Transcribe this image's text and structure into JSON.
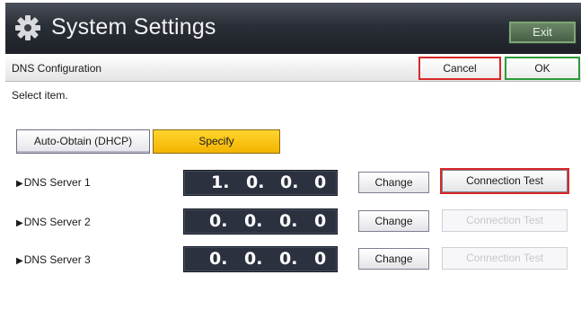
{
  "window": {
    "title": "System Settings",
    "exit_label": "Exit"
  },
  "header": {
    "page_title": "DNS Configuration",
    "cancel_label": "Cancel",
    "ok_label": "OK"
  },
  "prompt": "Select item.",
  "mode": {
    "auto_label": "Auto-Obtain (DHCP)",
    "specify_label": "Specify",
    "selected": "Specify"
  },
  "dns_servers": [
    {
      "label": "DNS Server 1",
      "octets": [
        "1.",
        "0.",
        "0.",
        "0"
      ],
      "change_label": "Change",
      "test_label": "Connection Test",
      "test_enabled": true
    },
    {
      "label": "DNS Server 2",
      "octets": [
        "0.",
        "0.",
        "0.",
        "0"
      ],
      "change_label": "Change",
      "test_label": "Connection Test",
      "test_enabled": false
    },
    {
      "label": "DNS Server 3",
      "octets": [
        "0.",
        "0.",
        "0.",
        "0"
      ],
      "change_label": "Change",
      "test_label": "Connection Test",
      "test_enabled": false
    }
  ],
  "colors": {
    "selected_mode": "#f3b400",
    "cancel_border": "#d82828",
    "ok_border": "#2d9a3a",
    "highlight": "#d82828"
  },
  "icons": {
    "title_icon": "gear-icon",
    "row_marker": "triangle-right-icon"
  }
}
